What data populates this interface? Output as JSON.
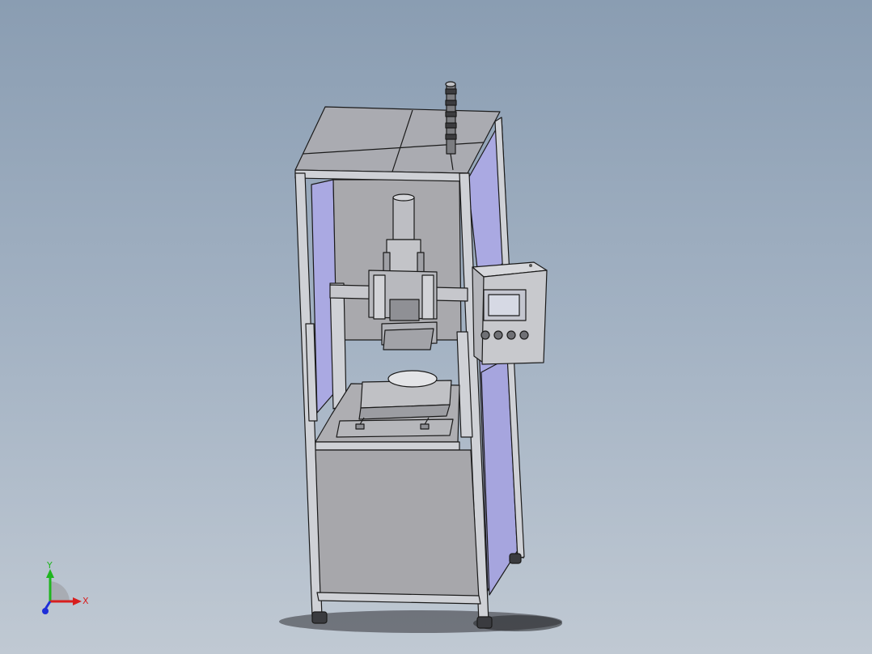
{
  "viewport": {
    "background_top": "#8a9db2",
    "background_bottom": "#c0c9d3",
    "model": "machine-assembly"
  },
  "triad": {
    "x_label": "X",
    "y_label": "Y",
    "x_color": "#d81e1e",
    "y_color": "#1fb51f",
    "z_color": "#1e2ed8"
  },
  "colors": {
    "frame": "#cfd1d6",
    "panel_gray": "#a7a7ab",
    "panel_purple": "#aaa9e2",
    "edge": "#1a1a1a",
    "screen": "#d6d9e4"
  }
}
